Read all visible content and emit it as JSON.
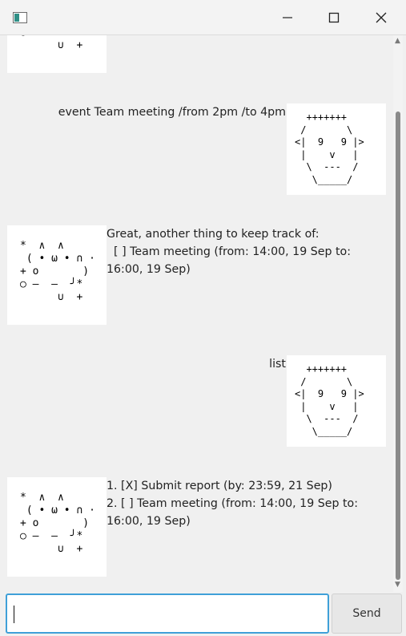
{
  "window": {
    "minimize_glyph": "—",
    "maximize_glyph": "☐",
    "close_glyph": "✕"
  },
  "icons": {
    "app": "window-app-icon",
    "scroll_up": "chevron-up-icon",
    "scroll_down": "chevron-down-icon"
  },
  "conversation": [
    {
      "role": "bot",
      "ascii": "  ┓   ╯\n  ○—╯+",
      "text": ""
    },
    {
      "role": "user",
      "text": "event Team meeting /from 2pm /to 4pm"
    },
    {
      "role": "bot",
      "text": "Great, another thing to keep track of:\n  [ ] Team meeting (from: 14:00, 19 Sep to: 16:00, 19 Sep)"
    },
    {
      "role": "user",
      "text": "list"
    },
    {
      "role": "bot",
      "text": "1. [X] Submit report (by: 23:59, 21 Sep)\n2. [ ] Team meeting (from: 14:00, 19 Sep to: 16:00, 19 Sep)"
    }
  ],
  "messages": {
    "user1": "event Team meeting /from 2pm /to 4pm",
    "bot1_line1": "Great, another thing to keep track of:",
    "bot1_line2": "  [ ] Team meeting (from: 14:00, 19 Sep to: 16:00, 19 Sep)",
    "user2": "list",
    "bot2_line1": "1. [X] Submit report (by: 23:59, 21 Sep)",
    "bot2_line2": "2. [ ] Team meeting (from: 14:00, 19 Sep to: 16:00, 19 Sep)"
  },
  "avatars": {
    "user_ascii": "  +++++++\n /       \\\n<|  9   9 |>\n |    v   |\n  \\  ---  /\n   \\_____/",
    "bot_ascii": "*  ∧  ∧\n ( • ω • ∩ ·\n+ o       )\n○ ―  ―  ╯*\n      ∪  +",
    "bot_partial_ascii": "      ∪ +"
  },
  "input": {
    "value": ""
  },
  "send_button": {
    "label": "Send"
  }
}
